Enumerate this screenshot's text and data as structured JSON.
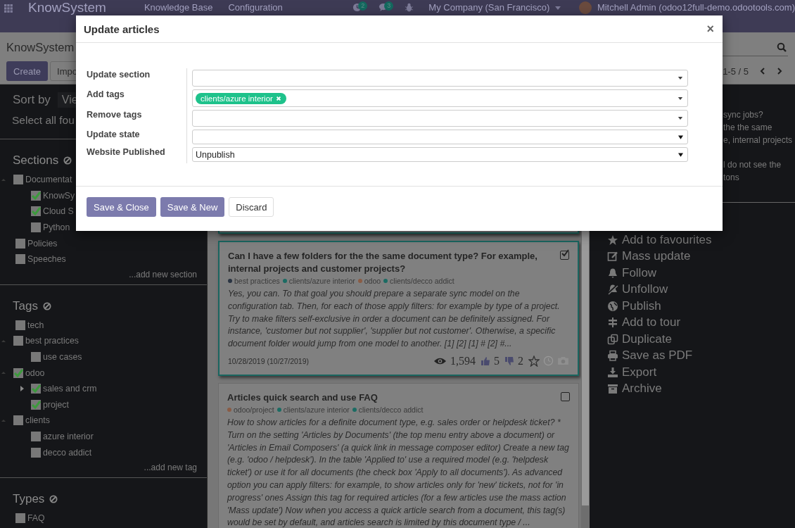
{
  "navbar": {
    "brand": "KnowSystem",
    "menus": [
      "Knowledge Base",
      "Configuration"
    ],
    "badges": [
      {
        "kind": "activity",
        "count": "2"
      },
      {
        "kind": "messages",
        "count": "3"
      }
    ],
    "company": "My Company (San Francisco)",
    "user": "Mitchell Admin (odoo12full-demo.odootools.com)"
  },
  "control_panel": {
    "breadcrumb": "KnowSystem",
    "buttons": [
      {
        "label": "Create",
        "kind": "primary"
      },
      {
        "label": "Impo",
        "kind": "secondary"
      }
    ],
    "pager": "1-5 / 5"
  },
  "sidebar": {
    "sort_label": "Sort by",
    "sort_value": "Vie",
    "select_all": "Select all fou",
    "groups": [
      {
        "title": "Sections",
        "add_link": "...add new section",
        "items": [
          {
            "label": "Documentat",
            "checked": false,
            "expanded": true,
            "children": [
              {
                "label": "KnowSy",
                "checked": true
              },
              {
                "label": "Cloud S",
                "checked": true
              },
              {
                "label": "Python",
                "checked": false
              }
            ]
          },
          {
            "label": "Policies",
            "checked": false
          },
          {
            "label": "Speeches",
            "checked": false
          }
        ]
      },
      {
        "title": "Tags",
        "add_link": "...add new tag",
        "items": [
          {
            "label": "tech",
            "checked": false
          },
          {
            "label": "best practices",
            "checked": false,
            "expanded": true,
            "children": [
              {
                "label": "use cases",
                "checked": false
              }
            ]
          },
          {
            "label": "odoo",
            "checked": true,
            "expanded": true,
            "children": [
              {
                "label": "sales and crm",
                "checked": true,
                "expanded": false
              },
              {
                "label": "project",
                "checked": true
              }
            ]
          },
          {
            "label": "clients",
            "checked": false,
            "expanded": true,
            "children": [
              {
                "label": "azure interior",
                "checked": false
              },
              {
                "label": "decco addict",
                "checked": false
              }
            ]
          }
        ]
      },
      {
        "title": "Types",
        "items": [
          {
            "label": "FAQ",
            "checked": false
          }
        ]
      }
    ]
  },
  "articles": [
    {
      "selected": true
    },
    {
      "selected": true,
      "title": "Can I have a few folders for the the same document type? For example, internal projects and customer projects?",
      "tags": [
        {
          "label": "best practices",
          "color": "#2a3442"
        },
        {
          "label": "clients/azure interior",
          "color": "#1b6b63"
        },
        {
          "label": "odoo",
          "color": "#8a5c45"
        },
        {
          "label": "clients/decco addict",
          "color": "#1b6b63"
        }
      ],
      "body": "Yes, you can. To that goal you should prepare a separate sync model on the configuration tab. Then, for each of those apply filters: for example by type of a project. Try to make filters self-exclusive in order a document can be definitely assigned. For instance, 'customer but not supplier', 'supplier but not customer'. Otherwise, a specific document folder would jump from one model to another. [1] [2] [1] # [2] #...",
      "footer": {
        "date": "10/28/2019 (10/27/2019)",
        "views": "1,594",
        "likes": "5",
        "dislikes": "2"
      }
    },
    {
      "selected": false,
      "title": "Articles quick search and use FAQ",
      "tags": [
        {
          "label": "odoo/project",
          "color": "#8a5c45"
        },
        {
          "label": "clients/azure interior",
          "color": "#1b6b63"
        },
        {
          "label": "clients/decco addict",
          "color": "#1b6b63"
        }
      ],
      "body": "How to show articles for a definite document type, e.g. sales order or helpdesk ticket? * Turn on the setting 'Articles by Documents' (the top menu entry above a document) or 'Articles in Email Composers' (a quick link in message composer editor) Create a new tag (e.g. 'odoo / helpdesk'). In the table 'Applied to' use a required model (e.g. 'helpdesk ticket') or use it for all documents (the check box 'Apply to all documents'). As advanced option you can apply filters: for example, to show articles only for 'new' tickets, not for 'in progress' ones Assign this tag for required articles (for a few articles use the mass action 'Mass update') Now when you access a quick article search from a document, this tag(s) would be set by default, and articles search is limited by this document type / ..."
    }
  ],
  "right_panel": {
    "selected_titles": [
      [
        "sync jobs?"
      ],
      [
        "the the same",
        "e, internal projects"
      ],
      [
        "l do not see the",
        "tons"
      ]
    ],
    "actions": [
      {
        "kind": "favourite",
        "label": "Add to favourites"
      },
      {
        "kind": "edit",
        "label": "Mass update"
      },
      {
        "kind": "follow",
        "label": "Follow"
      },
      {
        "kind": "unfollow",
        "label": "Unfollow"
      },
      {
        "kind": "publish",
        "label": "Publish"
      },
      {
        "kind": "tour",
        "label": "Add to tour"
      },
      {
        "kind": "duplicate",
        "label": "Duplicate"
      },
      {
        "kind": "pdf",
        "label": "Save as PDF"
      },
      {
        "kind": "export",
        "label": "Export"
      },
      {
        "kind": "archive",
        "label": "Archive"
      }
    ]
  },
  "dialog": {
    "title": "Update articles",
    "close": "×",
    "fields": [
      {
        "label": "Update section",
        "kind": "many2one"
      },
      {
        "label": "Add tags",
        "kind": "tags",
        "tags": [
          {
            "label": "clients/azure interior",
            "color": "#1ec28b"
          }
        ]
      },
      {
        "label": "Remove tags",
        "kind": "many2one"
      },
      {
        "label": "Update state",
        "kind": "select"
      },
      {
        "label": "Website Published",
        "kind": "select",
        "value": "Unpublish"
      }
    ],
    "buttons": [
      {
        "label": "Save & Close",
        "kind": "primary"
      },
      {
        "label": "Save & New",
        "kind": "primary"
      },
      {
        "label": "Discard",
        "kind": "secondary"
      }
    ]
  }
}
